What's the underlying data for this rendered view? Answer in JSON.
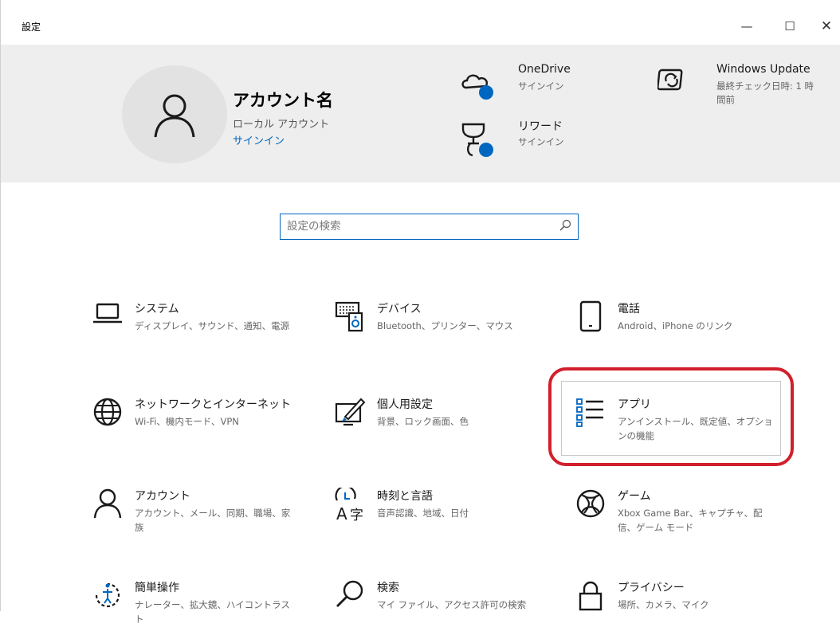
{
  "window": {
    "title": "設定",
    "minimize": "—",
    "maximize": "☐",
    "close": "✕"
  },
  "account": {
    "name": "アカウント名",
    "type": "ローカル アカウント",
    "signin": "サインイン"
  },
  "services": [
    {
      "title": "OneDrive",
      "sub": "サインイン",
      "icon": "cloud-icon"
    },
    {
      "title": "リワード",
      "sub": "サインイン",
      "icon": "trophy-icon"
    },
    {
      "title": "Windows Update",
      "sub": "最終チェック日時: 1 時間前",
      "icon": "refresh-icon"
    }
  ],
  "search": {
    "placeholder": "設定の検索"
  },
  "categories": [
    {
      "title": "システム",
      "sub": "ディスプレイ、サウンド、通知、電源",
      "icon": "laptop-icon"
    },
    {
      "title": "デバイス",
      "sub": "Bluetooth、プリンター、マウス",
      "icon": "keyboard-speaker-icon"
    },
    {
      "title": "電話",
      "sub": "Android、iPhone のリンク",
      "icon": "phone-icon"
    },
    {
      "title": "ネットワークとインターネット",
      "sub": "Wi-Fi、機内モード、VPN",
      "icon": "globe-icon"
    },
    {
      "title": "個人用設定",
      "sub": "背景、ロック画面、色",
      "icon": "pen-tablet-icon"
    },
    {
      "title": "アプリ",
      "sub": "アンインストール、既定値、オプションの機能",
      "icon": "app-list-icon"
    },
    {
      "title": "アカウント",
      "sub": "アカウント、メール、同期、職場、家族",
      "icon": "person-icon"
    },
    {
      "title": "時刻と言語",
      "sub": "音声認識、地域、日付",
      "icon": "time-language-icon"
    },
    {
      "title": "ゲーム",
      "sub": "Xbox Game Bar、キャプチャ、配信、ゲーム モード",
      "icon": "xbox-icon"
    },
    {
      "title": "簡単操作",
      "sub": "ナレーター、拡大鏡、ハイコントラスト",
      "icon": "ease-of-access-icon"
    },
    {
      "title": "検索",
      "sub": "マイ ファイル、アクセス許可の検索",
      "icon": "search-icon"
    },
    {
      "title": "プライバシー",
      "sub": "場所、カメラ、マイク",
      "icon": "lock-icon"
    }
  ],
  "colors": {
    "accent": "#0067c0",
    "header_bg": "#eeeeee",
    "highlight_ring": "#d1202b"
  }
}
